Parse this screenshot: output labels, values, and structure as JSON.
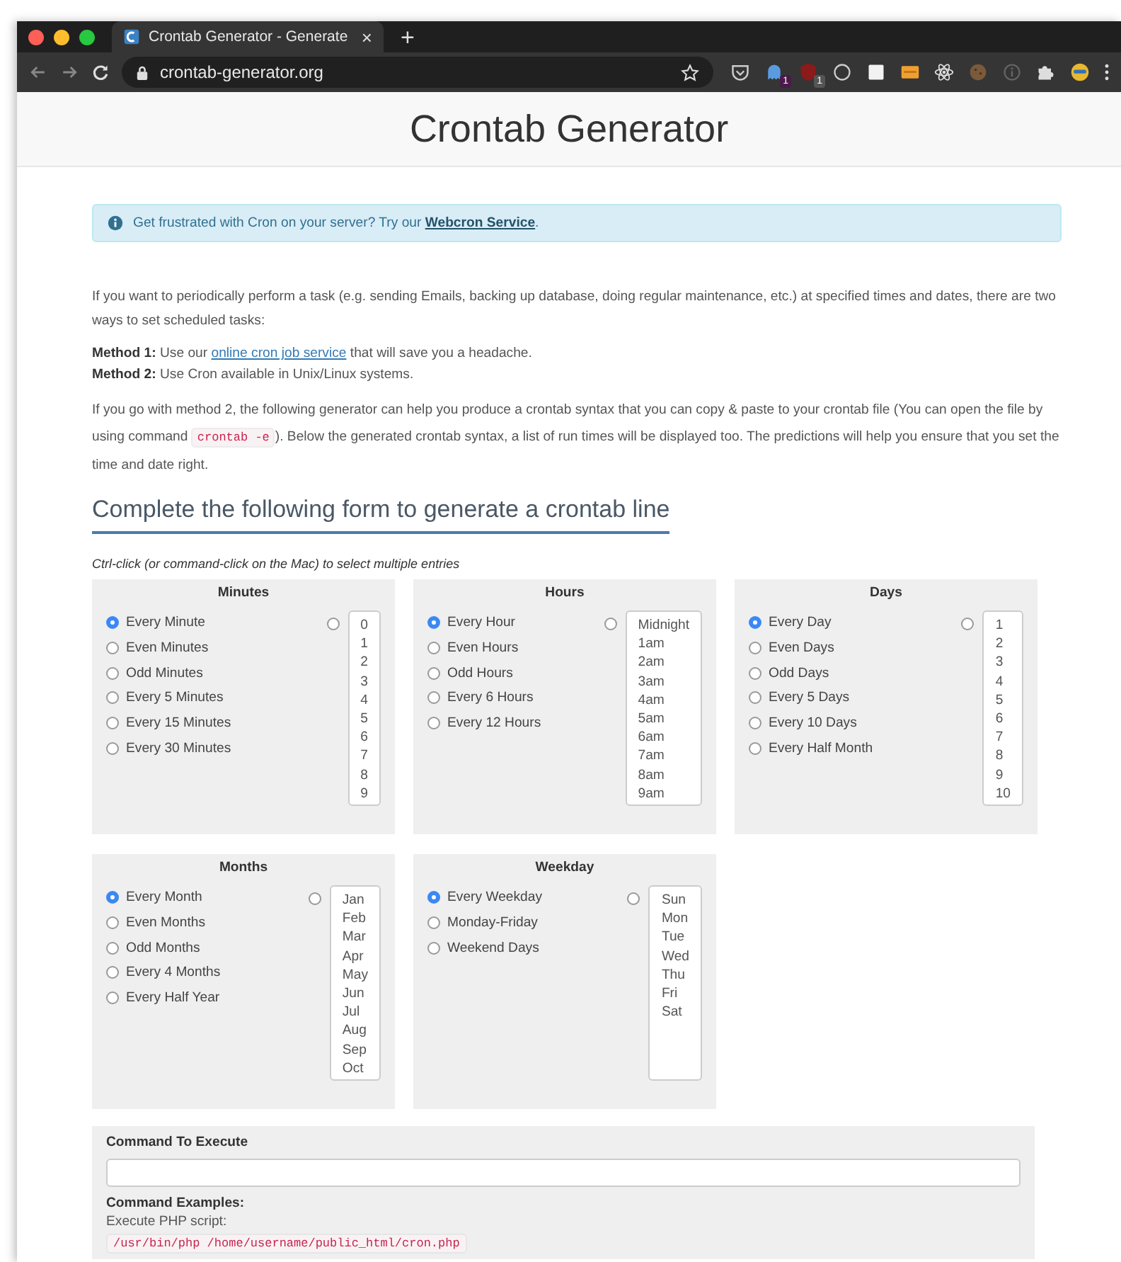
{
  "browser": {
    "tab_title": "Crontab Generator - Generate",
    "tab_close": "×",
    "new_tab": "+",
    "url": "crontab-generator.org",
    "badges": [
      "1",
      "1"
    ]
  },
  "page": {
    "title": "Crontab Generator",
    "alert": "Get frustrated with Cron on your server? Try our **Webcron Service**.",
    "intro": "If you want to periodically perform a task (e.g. sending Emails, backing up database, doing regular maintenance, etc.) at specified times and dates, there are two ways to set scheduled tasks:",
    "methods": [
      {
        "label": "Method 1:",
        "before": "Use our",
        "link": "online cron job service",
        "after": "that will save you a headache."
      },
      {
        "label": "Method 2:",
        "before": "Use Cron available in Unix/Linux systems."
      }
    ],
    "explain": {
      "before": "If you go with method 2, the following generator can help you produce a crontab syntax that you can copy & paste to your crontab file (You can open the file by using command",
      "code": "crontab -e",
      "after": "). Below the generated crontab syntax, a list of run times will be displayed too. The predictions will help you ensure that you set the time and date right."
    },
    "form_heading": "Complete the following form to generate a crontab line",
    "hint": "Ctrl-click (or command-click on the Mac) to select multiple entries",
    "panels": [
      {
        "title": "Minutes",
        "custom_selected": false,
        "options": [
          {
            "label": "Every Minute",
            "selected": true
          },
          {
            "label": "Even Minutes",
            "selected": false
          },
          {
            "label": "Odd Minutes",
            "selected": false
          },
          {
            "label": "Every 5 Minutes",
            "selected": false
          },
          {
            "label": "Every 15 Minutes",
            "selected": false
          },
          {
            "label": "Every 30 Minutes",
            "selected": false
          }
        ],
        "list": [
          "0",
          "1",
          "2",
          "3",
          "4",
          "5",
          "6",
          "7",
          "8",
          "9"
        ]
      },
      {
        "title": "Hours",
        "custom_selected": false,
        "options": [
          {
            "label": "Every Hour",
            "selected": true
          },
          {
            "label": "Even Hours",
            "selected": false
          },
          {
            "label": "Odd Hours",
            "selected": false
          },
          {
            "label": "Every 6 Hours",
            "selected": false
          },
          {
            "label": "Every 12 Hours",
            "selected": false
          }
        ],
        "list": [
          "Midnight",
          "1am",
          "2am",
          "3am",
          "4am",
          "5am",
          "6am",
          "7am",
          "8am",
          "9am"
        ]
      },
      {
        "title": "Days",
        "custom_selected": false,
        "options": [
          {
            "label": "Every Day",
            "selected": true
          },
          {
            "label": "Even Days",
            "selected": false
          },
          {
            "label": "Odd Days",
            "selected": false
          },
          {
            "label": "Every 5 Days",
            "selected": false
          },
          {
            "label": "Every 10 Days",
            "selected": false
          },
          {
            "label": "Every Half Month",
            "selected": false
          }
        ],
        "list": [
          "1",
          "2",
          "3",
          "4",
          "5",
          "6",
          "7",
          "8",
          "9",
          "10"
        ]
      },
      {
        "title": "Months",
        "custom_selected": false,
        "options": [
          {
            "label": "Every Month",
            "selected": true
          },
          {
            "label": "Even Months",
            "selected": false
          },
          {
            "label": "Odd Months",
            "selected": false
          },
          {
            "label": "Every 4 Months",
            "selected": false
          },
          {
            "label": "Every Half Year",
            "selected": false
          }
        ],
        "list": [
          "Jan",
          "Feb",
          "Mar",
          "Apr",
          "May",
          "Jun",
          "Jul",
          "Aug",
          "Sep",
          "Oct"
        ]
      },
      {
        "title": "Weekday",
        "custom_selected": false,
        "options": [
          {
            "label": "Every Weekday",
            "selected": true
          },
          {
            "label": "Monday-Friday",
            "selected": false
          },
          {
            "label": "Weekend Days",
            "selected": false
          }
        ],
        "list": [
          "Sun",
          "Mon",
          "Tue",
          "Wed",
          "Thu",
          "Fri",
          "Sat"
        ]
      }
    ],
    "command": {
      "label": "Command To Execute",
      "examples_heading": "Command Examples:",
      "example_label": "Execute PHP script:",
      "example_code": "/usr/bin/php /home/username/public_html/cron.php"
    }
  }
}
